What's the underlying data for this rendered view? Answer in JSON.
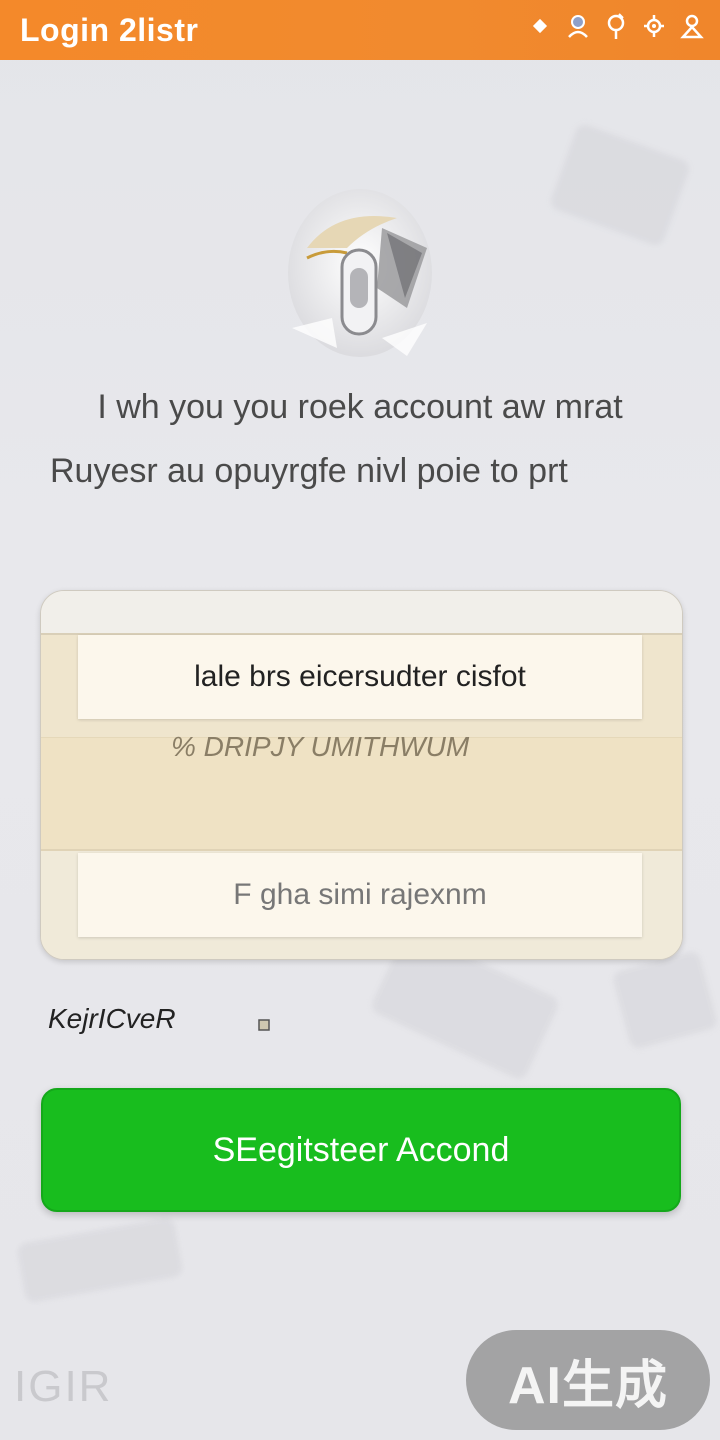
{
  "header": {
    "title": "Login  2listr",
    "icons": [
      "diamond-icon",
      "user-icon",
      "location-icon",
      "settings-icon",
      "account-icon"
    ]
  },
  "intro": {
    "line1": "I wh you you roek account aw mrat",
    "line2": "Ruyesr au opuyrgfe nivl poie to prt"
  },
  "form": {
    "field1_text": "lale  brs eicersudter cisfot",
    "middle_label": "% DRIPJY UMITHWUM",
    "field3_text": "F  gha simi rajexnm"
  },
  "remember_label": "KejrICveR",
  "register_button": "SEegitsteer Accond",
  "footer_logo": "IGIR",
  "watermark": "AI生成",
  "colors": {
    "header_orange": "#f4892a",
    "register_green": "#18bd1e"
  }
}
